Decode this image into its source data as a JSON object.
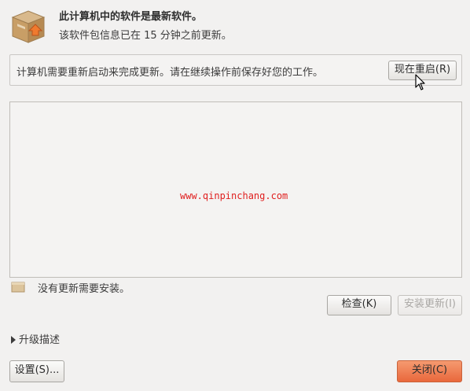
{
  "header": {
    "title": "此计算机中的软件是最新软件。",
    "subtitle": "该软件包信息已在 15 分钟之前更新。",
    "icon": "package-update-icon"
  },
  "restart_bar": {
    "message": "计算机需要重新启动来完成更新。请在继续操作前保存好您的工作。",
    "restart_label": "现在重启(R)"
  },
  "update_list": {
    "watermark": "www.qinpinchang.com"
  },
  "status": {
    "text": "没有更新需要安装。",
    "icon": "package-icon"
  },
  "actions": {
    "check_label": "检查(K)",
    "install_label": "安装更新(I)"
  },
  "expander": {
    "label": "升级描述"
  },
  "footer": {
    "settings_label": "设置(S)...",
    "close_label": "关闭(C)"
  },
  "colors": {
    "close_button": "#e9683c",
    "watermark": "#e02020",
    "window_bg": "#f2f1f0"
  }
}
